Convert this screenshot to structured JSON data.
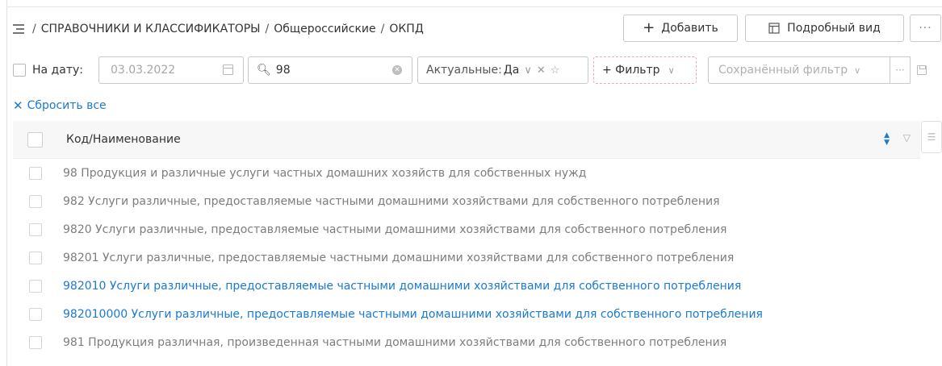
{
  "breadcrumb": {
    "items": [
      "СПРАВОЧНИКИ И КЛАССИФИКАТОРЫ",
      "Общероссийские",
      "ОКПД"
    ],
    "separator": "/"
  },
  "toolbar": {
    "add_label": "Добавить",
    "add_icon": "plus-icon",
    "detail_label": "Подробный вид",
    "detail_icon": "detail-view-icon",
    "more_label": "···"
  },
  "filters": {
    "date_label": "На дату:",
    "date_checked": false,
    "date_value": "03.03.2022",
    "search_value": "98",
    "actual_label": "Актуальные:",
    "actual_value": "Да",
    "add_filter_label": "+ Фильтр",
    "saved_filter_placeholder": "Сохранённый фильтр",
    "saved_more_label": "···",
    "reset_label": "Сбросить все"
  },
  "table": {
    "column_header": "Код/Наименование",
    "rows": [
      {
        "text": "98 Продукция и различные услуги частных домашних хозяйств для собственных нужд",
        "link": false
      },
      {
        "text": "982 Услуги различные, предоставляемые частными домашними хозяйствами для собственного потребления",
        "link": false
      },
      {
        "text": "9820 Услуги различные, предоставляемые частными домашними хозяйствами для собственного потребления",
        "link": false
      },
      {
        "text": "98201 Услуги различные, предоставляемые частными домашними хозяйствами для собственного потребления",
        "link": false
      },
      {
        "text": "982010 Услуги различные, предоставляемые частными домашними хозяйствами для собственного потребления",
        "link": true
      },
      {
        "text": "982010000 Услуги различные, предоставляемые частными домашними хозяйствами для собственного потребления",
        "link": true
      },
      {
        "text": "981 Продукция различная, произведенная частными домашними хозяйствами для собственного потребления",
        "link": false
      }
    ]
  },
  "colors": {
    "accent": "#1a7ad1",
    "muted_text": "#7d7d7d",
    "header_bg": "#f7f7f7",
    "dashed_border": "#e3a6c6"
  }
}
